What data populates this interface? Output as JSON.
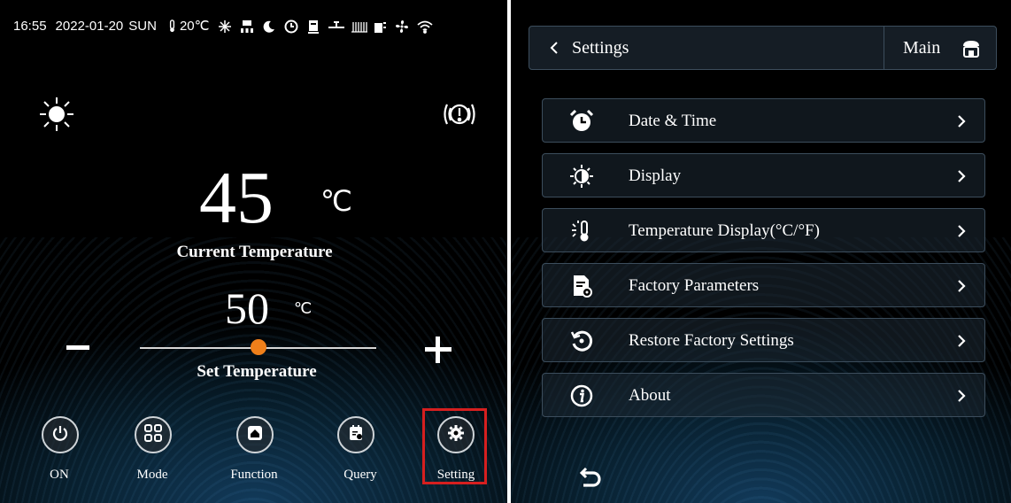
{
  "status_bar": {
    "time": "16:55",
    "date": "2022-01-20",
    "weekday": "SUN",
    "outdoor_temp": "20℃",
    "icons": [
      "thermometer-icon",
      "defrost-icon",
      "heater-icon",
      "night-mode-icon",
      "timer-icon",
      "tank-icon",
      "valve-icon",
      "heating-coil-icon",
      "pump-icon",
      "fan-icon",
      "wifi-icon"
    ]
  },
  "home": {
    "weather_icon": "sun-icon",
    "alarm_icon": "alarm-icon",
    "current_temp": "45",
    "current_unit": "℃",
    "current_label": "Current Temperature",
    "set_temp": "50",
    "set_unit": "℃",
    "set_label": "Set Temperature",
    "set_level": 0.5,
    "nav": [
      {
        "label": "ON",
        "icon": "power-icon"
      },
      {
        "label": "Mode",
        "icon": "mode-grid-icon"
      },
      {
        "label": "Function",
        "icon": "function-icon"
      },
      {
        "label": "Query",
        "icon": "query-icon"
      },
      {
        "label": "Setting",
        "icon": "gear-icon",
        "highlighted": true
      }
    ]
  },
  "settings": {
    "title": "Settings",
    "main_label": "Main",
    "items": [
      {
        "label": "Date & Time",
        "icon": "alarm-clock-icon"
      },
      {
        "label": "Display",
        "icon": "brightness-icon"
      },
      {
        "label": "Temperature Display(°C/°F)",
        "icon": "temperature-icon"
      },
      {
        "label": "Factory Parameters",
        "icon": "factory-document-icon"
      },
      {
        "label": "Restore Factory Settings",
        "icon": "restore-icon"
      },
      {
        "label": "About",
        "icon": "info-icon"
      }
    ]
  },
  "colors": {
    "accent": "#ef7f1a",
    "highlight": "#d61f1f",
    "border": "#3c4d5c"
  }
}
